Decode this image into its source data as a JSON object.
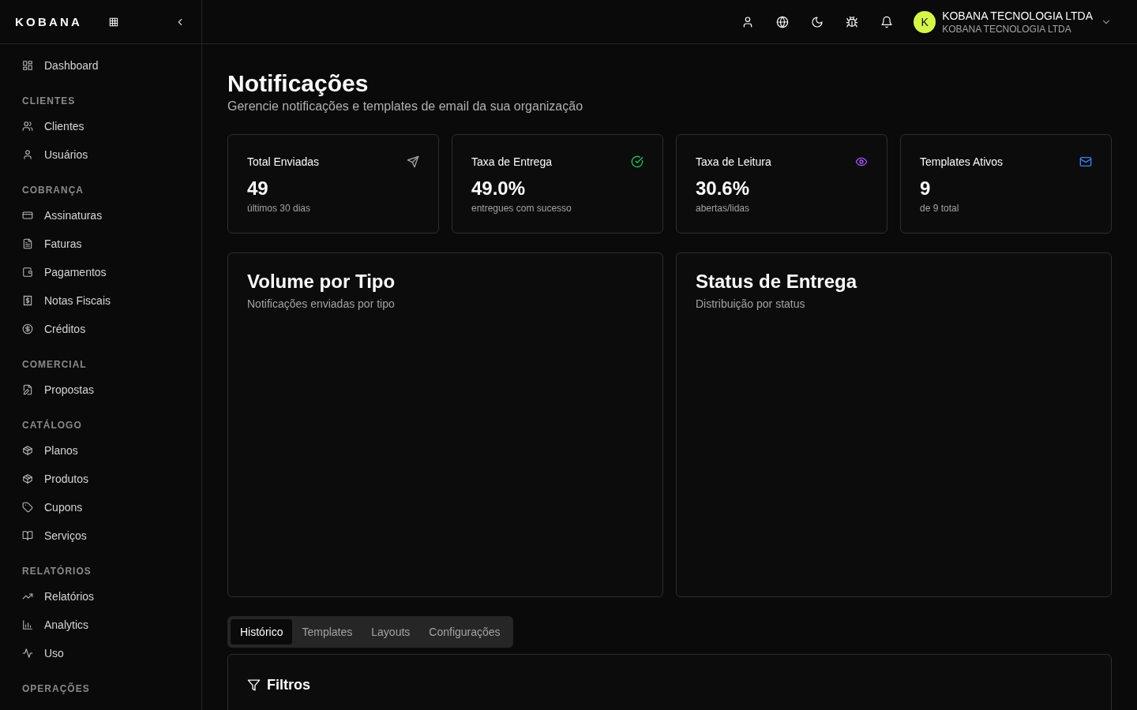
{
  "logo": "KOBANA",
  "sidebar": {
    "items": [
      {
        "label": "Dashboard",
        "kind": "grid"
      }
    ],
    "sections": [
      {
        "title": "CLIENTES",
        "items": [
          {
            "label": "Clientes",
            "kind": "users"
          },
          {
            "label": "Usuários",
            "kind": "user"
          }
        ]
      },
      {
        "title": "COBRANÇA",
        "items": [
          {
            "label": "Assinaturas",
            "kind": "card"
          },
          {
            "label": "Faturas",
            "kind": "file"
          },
          {
            "label": "Pagamentos",
            "kind": "wallet"
          },
          {
            "label": "Notas Fiscais",
            "kind": "receipt"
          },
          {
            "label": "Créditos",
            "kind": "coin"
          }
        ]
      },
      {
        "title": "COMERCIAL",
        "items": [
          {
            "label": "Propostas",
            "kind": "filepen"
          }
        ]
      },
      {
        "title": "CATÁLOGO",
        "items": [
          {
            "label": "Planos",
            "kind": "box"
          },
          {
            "label": "Produtos",
            "kind": "box"
          },
          {
            "label": "Cupons",
            "kind": "tag"
          },
          {
            "label": "Serviços",
            "kind": "book"
          }
        ]
      },
      {
        "title": "RELATÓRIOS",
        "items": [
          {
            "label": "Relatórios",
            "kind": "trend"
          },
          {
            "label": "Analytics",
            "kind": "bars"
          },
          {
            "label": "Uso",
            "kind": "pulse"
          }
        ]
      },
      {
        "title": "OPERAÇÕES"
      }
    ]
  },
  "header": {
    "avatar": "K",
    "org_name": "KOBANA TECNOLOGIA LTDA",
    "org_sub": "KOBANA TECNOLOGIA LTDA"
  },
  "page": {
    "title": "Notificações",
    "subtitle": "Gerencie notificações e templates de email da sua organização"
  },
  "stats": [
    {
      "label": "Total Enviadas",
      "value": "49",
      "note": "últimos 30 dias",
      "kind": "send",
      "color": "#a3a3a3"
    },
    {
      "label": "Taxa de Entrega",
      "value": "49.0%",
      "note": "entregues com sucesso",
      "kind": "check",
      "color": "#22c55e"
    },
    {
      "label": "Taxa de Leitura",
      "value": "30.6%",
      "note": "abertas/lidas",
      "kind": "eye",
      "color": "#a855f7"
    },
    {
      "label": "Templates Ativos",
      "value": "9",
      "note": "de 9 total",
      "kind": "mail",
      "color": "#3b82f6"
    }
  ],
  "panels": [
    {
      "title": "Volume por Tipo",
      "subtitle": "Notificações enviadas por tipo"
    },
    {
      "title": "Status de Entrega",
      "subtitle": "Distribuição por status"
    }
  ],
  "tabs": [
    {
      "label": "Histórico",
      "selected": true
    },
    {
      "label": "Templates",
      "selected": false
    },
    {
      "label": "Layouts",
      "selected": false
    },
    {
      "label": "Configurações",
      "selected": false
    }
  ],
  "filters": {
    "title": "Filtros"
  }
}
